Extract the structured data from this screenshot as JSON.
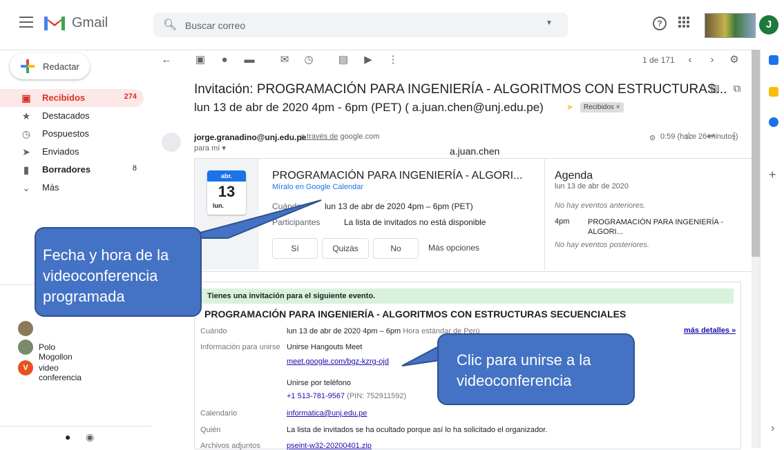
{
  "header": {
    "app_name": "Gmail",
    "search_placeholder": "Buscar correo",
    "account_initial": "J"
  },
  "sidebar": {
    "compose": "Redactar",
    "items": [
      {
        "label": "Recibidos",
        "count": "274",
        "icon": "inbox-icon"
      },
      {
        "label": "Destacados",
        "count": "",
        "icon": "star-icon"
      },
      {
        "label": "Pospuestos",
        "count": "",
        "icon": "clock-icon"
      },
      {
        "label": "Enviados",
        "count": "",
        "icon": "send-icon"
      },
      {
        "label": "Borradores",
        "count": "8",
        "icon": "draft-icon"
      },
      {
        "label": "Más",
        "count": "",
        "icon": "chevron-down-icon"
      }
    ],
    "contacts": [
      {
        "name": "Polo Mogollon"
      },
      {
        "name": "video conferencia",
        "initial": "V"
      }
    ]
  },
  "toolbar": {
    "pager": "1 de 171"
  },
  "email": {
    "subject_line1": "Invitación: PROGRAMACIÓN PARA INGENIERÍA - ALGORITMOS CON ESTRUCTURAS...",
    "subject_line2": "lun 13 de abr de 2020 4pm - 6pm (PET) ( a.juan.chen@unj.edu.pe)",
    "label": "Recibidos ×",
    "sender": "jorge.granadino@unj.edu.pe",
    "via_text": "a través de",
    "via_domain": "google.com",
    "to": "para mí ▾",
    "timestamp": "0:59 (hace 26 minutos)",
    "recipient_name": "a.juan.chen"
  },
  "event_card": {
    "month": "abr.",
    "day": "13",
    "weekday": "lun.",
    "title": "PROGRAMACIÓN PARA INGENIERÍA - ALGORI...",
    "calendar_link": "Míralo en Google Calendar",
    "when_label": "Cuándo",
    "when_value": "lun 13 de abr de 2020 4pm – 6pm (PET)",
    "participants_label": "Participantes",
    "participants_value": "La lista de invitados no está disponible",
    "rsvp_yes": "Sí",
    "rsvp_maybe": "Quizás",
    "rsvp_no": "No",
    "more_options": "Más opciones",
    "agenda_title": "Agenda",
    "agenda_date": "lun 13 de abr de 2020",
    "agenda_no_prev": "No hay eventos anteriores.",
    "agenda_time": "4pm",
    "agenda_event": "PROGRAMACIÓN PARA INGENIERÍA - ALGORI...",
    "agenda_no_next": "No hay eventos posteriores."
  },
  "invitation": {
    "banner": "Tienes una invitación para el siguiente evento.",
    "title": "PROGRAMACIÓN PARA INGENIERÍA - ALGORITMOS CON ESTRUCTURAS SECUENCIALES",
    "when_label": "Cuándo",
    "when_value": "lun 13 de abr de 2020 4pm – 6pm",
    "when_tz": "Hora estándar de Perú",
    "more_details": "más detalles »",
    "join_label": "Información para unirse",
    "join_title": "Unirse Hangouts Meet",
    "meet_link": "meet.google.com/bgz-kzrg-ojd",
    "phone_title": "Unirse por teléfono",
    "phone_number": "+1 513-781-9567",
    "phone_pin": "(PIN: 752911592)",
    "calendar_label": "Calendario",
    "calendar_value": "informatica@unj.edu.pe",
    "who_label": "Quién",
    "who_value": "La lista de invitados se ha ocultado porque así lo ha solicitado el organizador.",
    "attach_label": "Archivos adjuntos",
    "attach_value": "pseint-w32-20200401.zip"
  },
  "callouts": {
    "date_time": "Fecha y hora de la videoconferencia programada",
    "join": "Clic para unirse a la videoconferencia"
  },
  "colors": {
    "accent": "#d93025",
    "blue": "#1a73e8",
    "callout": "#4472c4"
  }
}
